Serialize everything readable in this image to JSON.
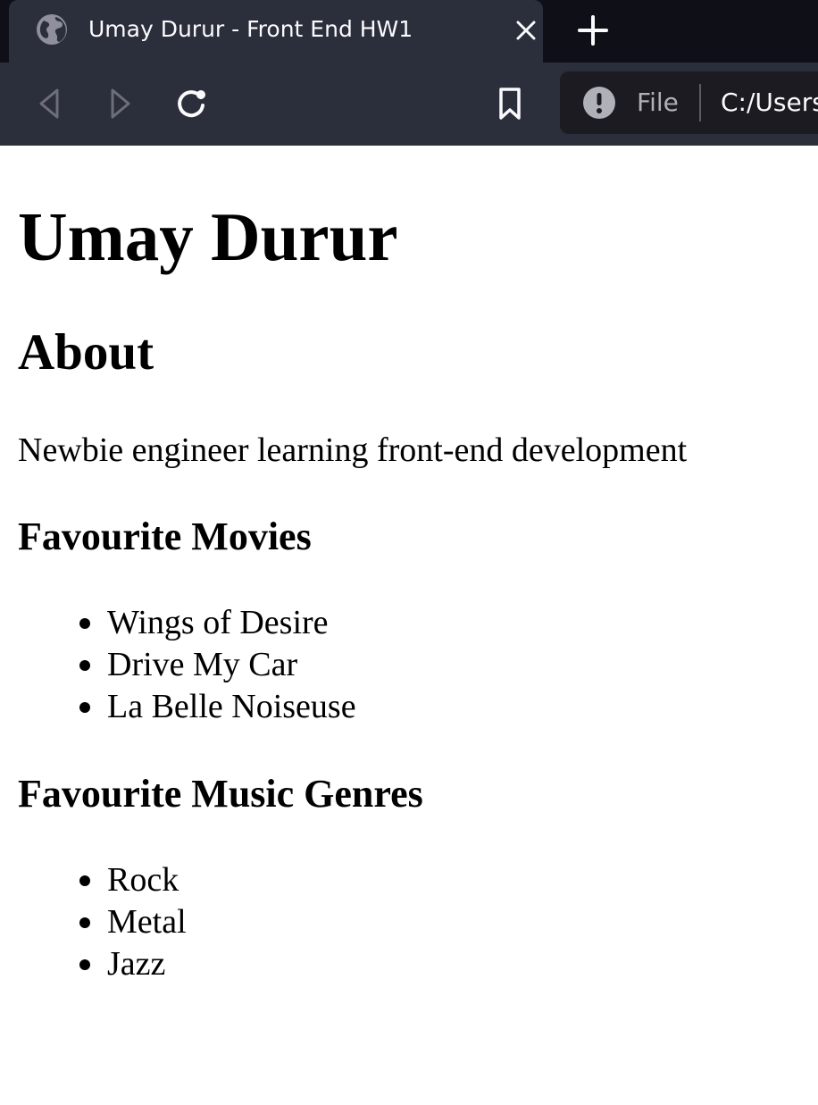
{
  "browser": {
    "tab": {
      "title": "Umay Durur - Front End HW1",
      "favicon": "globe-icon",
      "close_icon": "close-icon"
    },
    "new_tab_icon": "plus-icon",
    "toolbar": {
      "back_icon": "back-arrow-icon",
      "forward_icon": "forward-arrow-icon",
      "reload_icon": "reload-icon",
      "bookmark_icon": "bookmark-icon"
    },
    "urlbar": {
      "security_icon": "warning-icon",
      "scheme_label": "File",
      "url": "C:/Users"
    },
    "colors": {
      "tabstrip_bg": "#0f0f17",
      "toolbar_bg": "#2b2e3b",
      "urlbar_bg": "#1c1b22",
      "text_light": "#fbfbfe",
      "icon_disabled": "#8f8f9d"
    }
  },
  "page": {
    "title": "Umay Durur",
    "about_heading": "About",
    "about_text": "Newbie engineer learning front-end development",
    "movies_heading": "Favourite Movies",
    "movies": [
      "Wings of Desire",
      "Drive My Car",
      "La Belle Noiseuse"
    ],
    "music_heading": "Favourite Music Genres",
    "music": [
      "Rock",
      "Metal",
      "Jazz"
    ]
  }
}
